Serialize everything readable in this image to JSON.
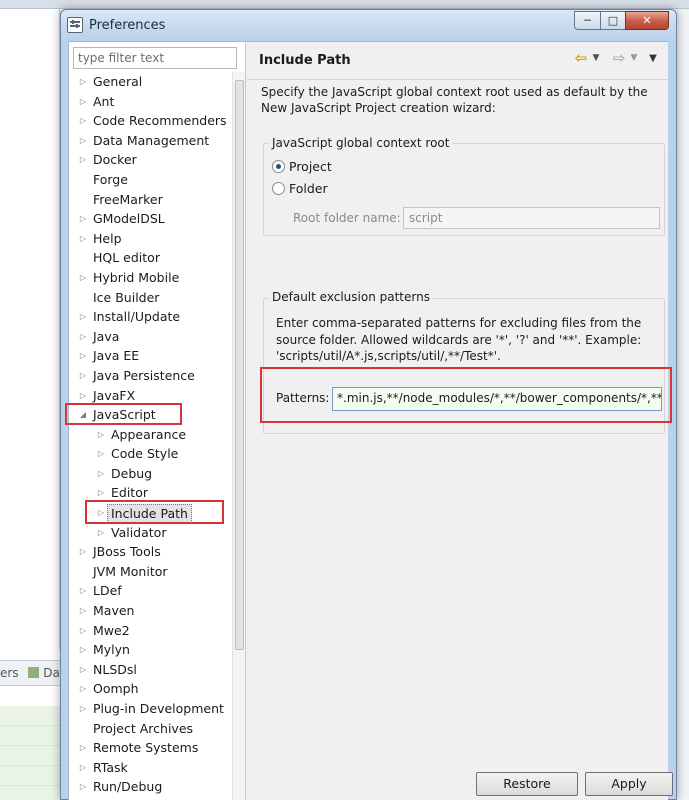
{
  "background": {
    "tab_text": "ers",
    "tab2_text": "Da"
  },
  "window": {
    "title": "Preferences",
    "minimize": "─",
    "maximize": "□",
    "close": "✕"
  },
  "filter": {
    "placeholder": "type filter text"
  },
  "tree": {
    "items": [
      {
        "label": "General",
        "level": 0,
        "has_children": true
      },
      {
        "label": "Ant",
        "level": 0,
        "has_children": true
      },
      {
        "label": "Code Recommenders",
        "level": 0,
        "has_children": true
      },
      {
        "label": "Data Management",
        "level": 0,
        "has_children": true
      },
      {
        "label": "Docker",
        "level": 0,
        "has_children": true
      },
      {
        "label": "Forge",
        "level": 0,
        "has_children": false
      },
      {
        "label": "FreeMarker",
        "level": 0,
        "has_children": false
      },
      {
        "label": "GModelDSL",
        "level": 0,
        "has_children": true
      },
      {
        "label": "Help",
        "level": 0,
        "has_children": true
      },
      {
        "label": "HQL editor",
        "level": 0,
        "has_children": false
      },
      {
        "label": "Hybrid Mobile",
        "level": 0,
        "has_children": true
      },
      {
        "label": "Ice Builder",
        "level": 0,
        "has_children": false
      },
      {
        "label": "Install/Update",
        "level": 0,
        "has_children": true
      },
      {
        "label": "Java",
        "level": 0,
        "has_children": true
      },
      {
        "label": "Java EE",
        "level": 0,
        "has_children": true
      },
      {
        "label": "Java Persistence",
        "level": 0,
        "has_children": true
      },
      {
        "label": "JavaFX",
        "level": 0,
        "has_children": true
      },
      {
        "label": "JavaScript",
        "level": 0,
        "has_children": true,
        "expanded": true
      },
      {
        "label": "Appearance",
        "level": 1,
        "has_children": true
      },
      {
        "label": "Code Style",
        "level": 1,
        "has_children": true
      },
      {
        "label": "Debug",
        "level": 1,
        "has_children": true
      },
      {
        "label": "Editor",
        "level": 1,
        "has_children": true
      },
      {
        "label": "Include Path",
        "level": 1,
        "has_children": true,
        "selected": true
      },
      {
        "label": "Validator",
        "level": 1,
        "has_children": true
      },
      {
        "label": "JBoss Tools",
        "level": 0,
        "has_children": true
      },
      {
        "label": "JVM Monitor",
        "level": 0,
        "has_children": false
      },
      {
        "label": "LDef",
        "level": 0,
        "has_children": true
      },
      {
        "label": "Maven",
        "level": 0,
        "has_children": true
      },
      {
        "label": "Mwe2",
        "level": 0,
        "has_children": true
      },
      {
        "label": "Mylyn",
        "level": 0,
        "has_children": true
      },
      {
        "label": "NLSDsl",
        "level": 0,
        "has_children": true
      },
      {
        "label": "Oomph",
        "level": 0,
        "has_children": true
      },
      {
        "label": "Plug-in Development",
        "level": 0,
        "has_children": true
      },
      {
        "label": "Project Archives",
        "level": 0,
        "has_children": false
      },
      {
        "label": "Remote Systems",
        "level": 0,
        "has_children": true
      },
      {
        "label": "RTask",
        "level": 0,
        "has_children": true
      },
      {
        "label": "Run/Debug",
        "level": 0,
        "has_children": true
      }
    ]
  },
  "page": {
    "title": "Include Path",
    "description": "Specify the JavaScript global context root used as default by the New JavaScript Project creation wizard:",
    "nav": {
      "back": "⇦",
      "forward": "⇨",
      "dropdown": "▼",
      "menu": "▼"
    },
    "context_group": {
      "title": "JavaScript global context root",
      "project_label": "Project",
      "folder_label": "Folder",
      "selected": "Project",
      "root_folder_label": "Root folder name:",
      "root_folder_value": "script"
    },
    "exclusion_group": {
      "title": "Default exclusion patterns",
      "description": "Enter comma-separated patterns for excluding files from the source folder. Allowed wildcards are '*', '?' and '**'. Example: 'scripts/util/A*.js,scripts/util/,**/Test*'.",
      "patterns_label": "Patterns:",
      "patterns_value": "*.min.js,**/node_modules/*,**/bower_components/*,**/*.js"
    },
    "buttons": {
      "restore": "Restore Defaults",
      "apply": "Apply"
    }
  },
  "colors": {
    "highlight": "#d6353a",
    "selection": "#e3e3e3",
    "patterns_bg": "#f4fbef"
  }
}
